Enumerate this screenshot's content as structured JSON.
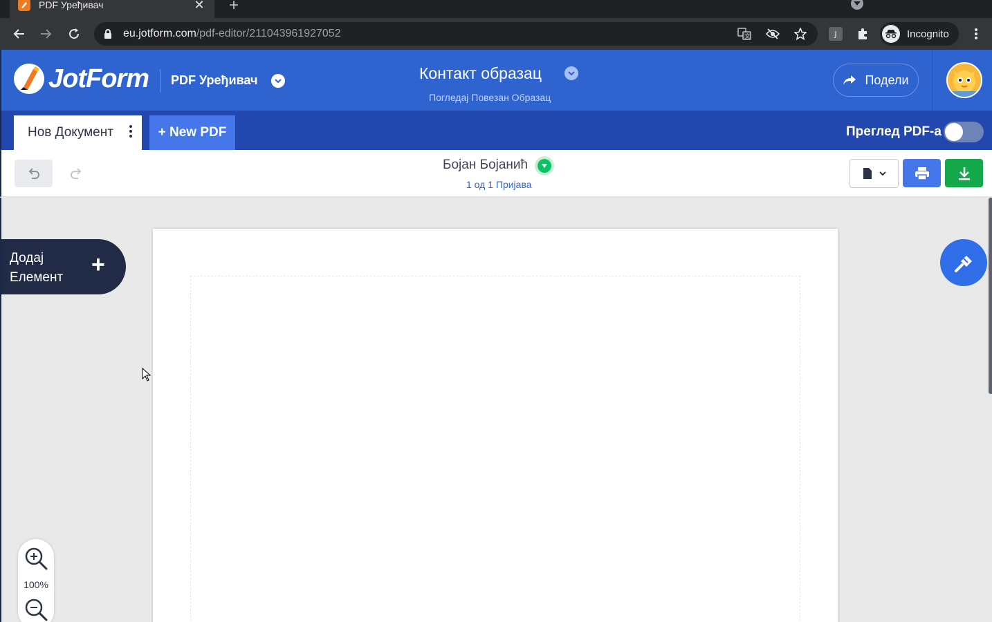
{
  "browser": {
    "tab_title": "PDF Уређивач",
    "tab_close": "✕",
    "new_tab": "+",
    "url_host": "eu.jotform.com",
    "url_path": "/pdf-editor/211043961927052",
    "incognito_label": "Incognito"
  },
  "header": {
    "logo_text": "JotForm",
    "product_name": "PDF Уређивач",
    "form_title": "Контакт образац",
    "form_subtitle": "Погледај Повезан Образац",
    "share_label": "Подели"
  },
  "subnav": {
    "document_tab": "Нов Документ",
    "new_pdf_label": "+ New PDF",
    "preview_label": "Преглед PDF-а",
    "preview_enabled": false
  },
  "actionbar": {
    "submission_name": "Бојан Бојанић",
    "submission_count": "1 од 1 Пријава"
  },
  "canvas": {
    "add_element_label": "Додај Елемент",
    "add_element_plus": "+",
    "zoom_level": "100%"
  },
  "colors": {
    "header_blue": "#2f63cf",
    "subnav_blue": "#2248b0",
    "new_pdf_blue": "#4577ea",
    "download_green": "#14a84a",
    "add_element_bg": "#222b45"
  }
}
